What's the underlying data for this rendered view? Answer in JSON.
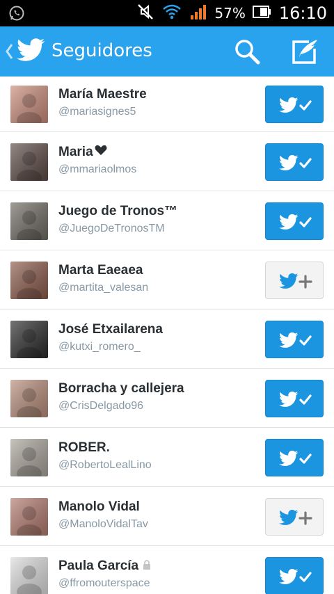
{
  "status": {
    "battery_pct": "57%",
    "time": "16:10"
  },
  "header": {
    "title": "Seguidores"
  },
  "followers": [
    {
      "name": "María Maestre",
      "handle": "@mariasignes5",
      "following": true,
      "protected": false,
      "avatar_color": "#c98b7a"
    },
    {
      "name": "Maria",
      "handle": "@mmariaolmos",
      "following": true,
      "protected": false,
      "avatar_color": "#5d4b45"
    },
    {
      "name": "Juego de Tronos™",
      "handle": "@JuegoDeTronosTM",
      "following": true,
      "protected": false,
      "avatar_color": "#6f6a62"
    },
    {
      "name": "Marta Eaeaea",
      "handle": "@martita_valesan",
      "following": false,
      "protected": false,
      "avatar_color": "#8a5a4a"
    },
    {
      "name": "José Etxailarena",
      "handle": "@kutxi_romero_",
      "following": true,
      "protected": false,
      "avatar_color": "#2b2b2b"
    },
    {
      "name": "Borracha y callejera",
      "handle": "@CrisDelgado96",
      "following": true,
      "protected": false,
      "avatar_color": "#b68c7a"
    },
    {
      "name": "ROBER.",
      "handle": "@RobertoLealLino",
      "following": true,
      "protected": false,
      "avatar_color": "#a9a39a"
    },
    {
      "name": "Manolo Vidal",
      "handle": "@ManoloVidalTav",
      "following": false,
      "protected": false,
      "avatar_color": "#b27a6e"
    },
    {
      "name": "Paula García",
      "handle": "@ffromouterspace",
      "following": true,
      "protected": true,
      "avatar_color": "#dcdcdc"
    }
  ],
  "colors": {
    "brand": "#2aa3ef",
    "follow_on": "#1b95e0",
    "follow_off": "#f3f3f3"
  }
}
